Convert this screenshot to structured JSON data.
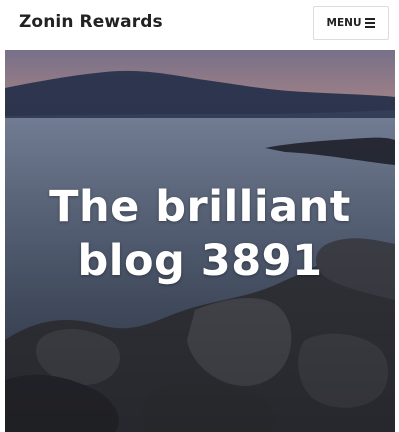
{
  "header": {
    "site_title": "Zonin Rewards",
    "menu_label": "MENU",
    "menu_icon": "hamburger-icon"
  },
  "hero": {
    "title_line1": "The brilliant",
    "title_line2": "blog 3891",
    "background": "dusk-lake-rocks-photo"
  }
}
